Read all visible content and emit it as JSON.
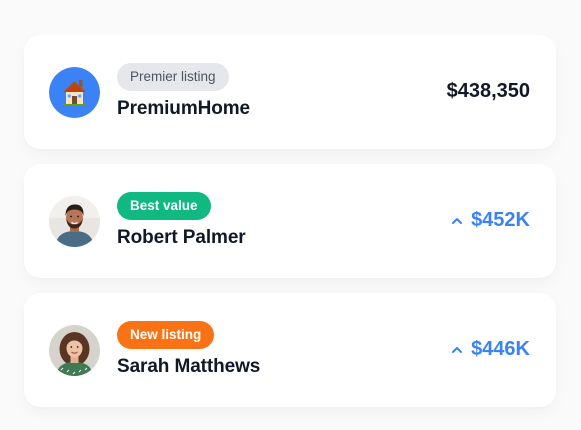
{
  "colors": {
    "home_avatar_bg": "#3b82f6",
    "badge_gray": "#e5e7eb",
    "badge_green": "#10b981",
    "badge_orange": "#f97316",
    "price_blue": "#3b82f6",
    "text_dark": "#111827"
  },
  "listings": [
    {
      "badge": "Premier listing",
      "name": "PremiumHome",
      "price": "$438,350",
      "avatar_icon": "house-icon",
      "trend_icon": null
    },
    {
      "badge": "Best value",
      "name": "Robert Palmer",
      "price": "$452K",
      "avatar_icon": "person-avatar",
      "trend_icon": "chevron-up-icon"
    },
    {
      "badge": "New listing",
      "name": "Sarah Matthews",
      "price": "$446K",
      "avatar_icon": "person-avatar",
      "trend_icon": "chevron-up-icon"
    }
  ]
}
